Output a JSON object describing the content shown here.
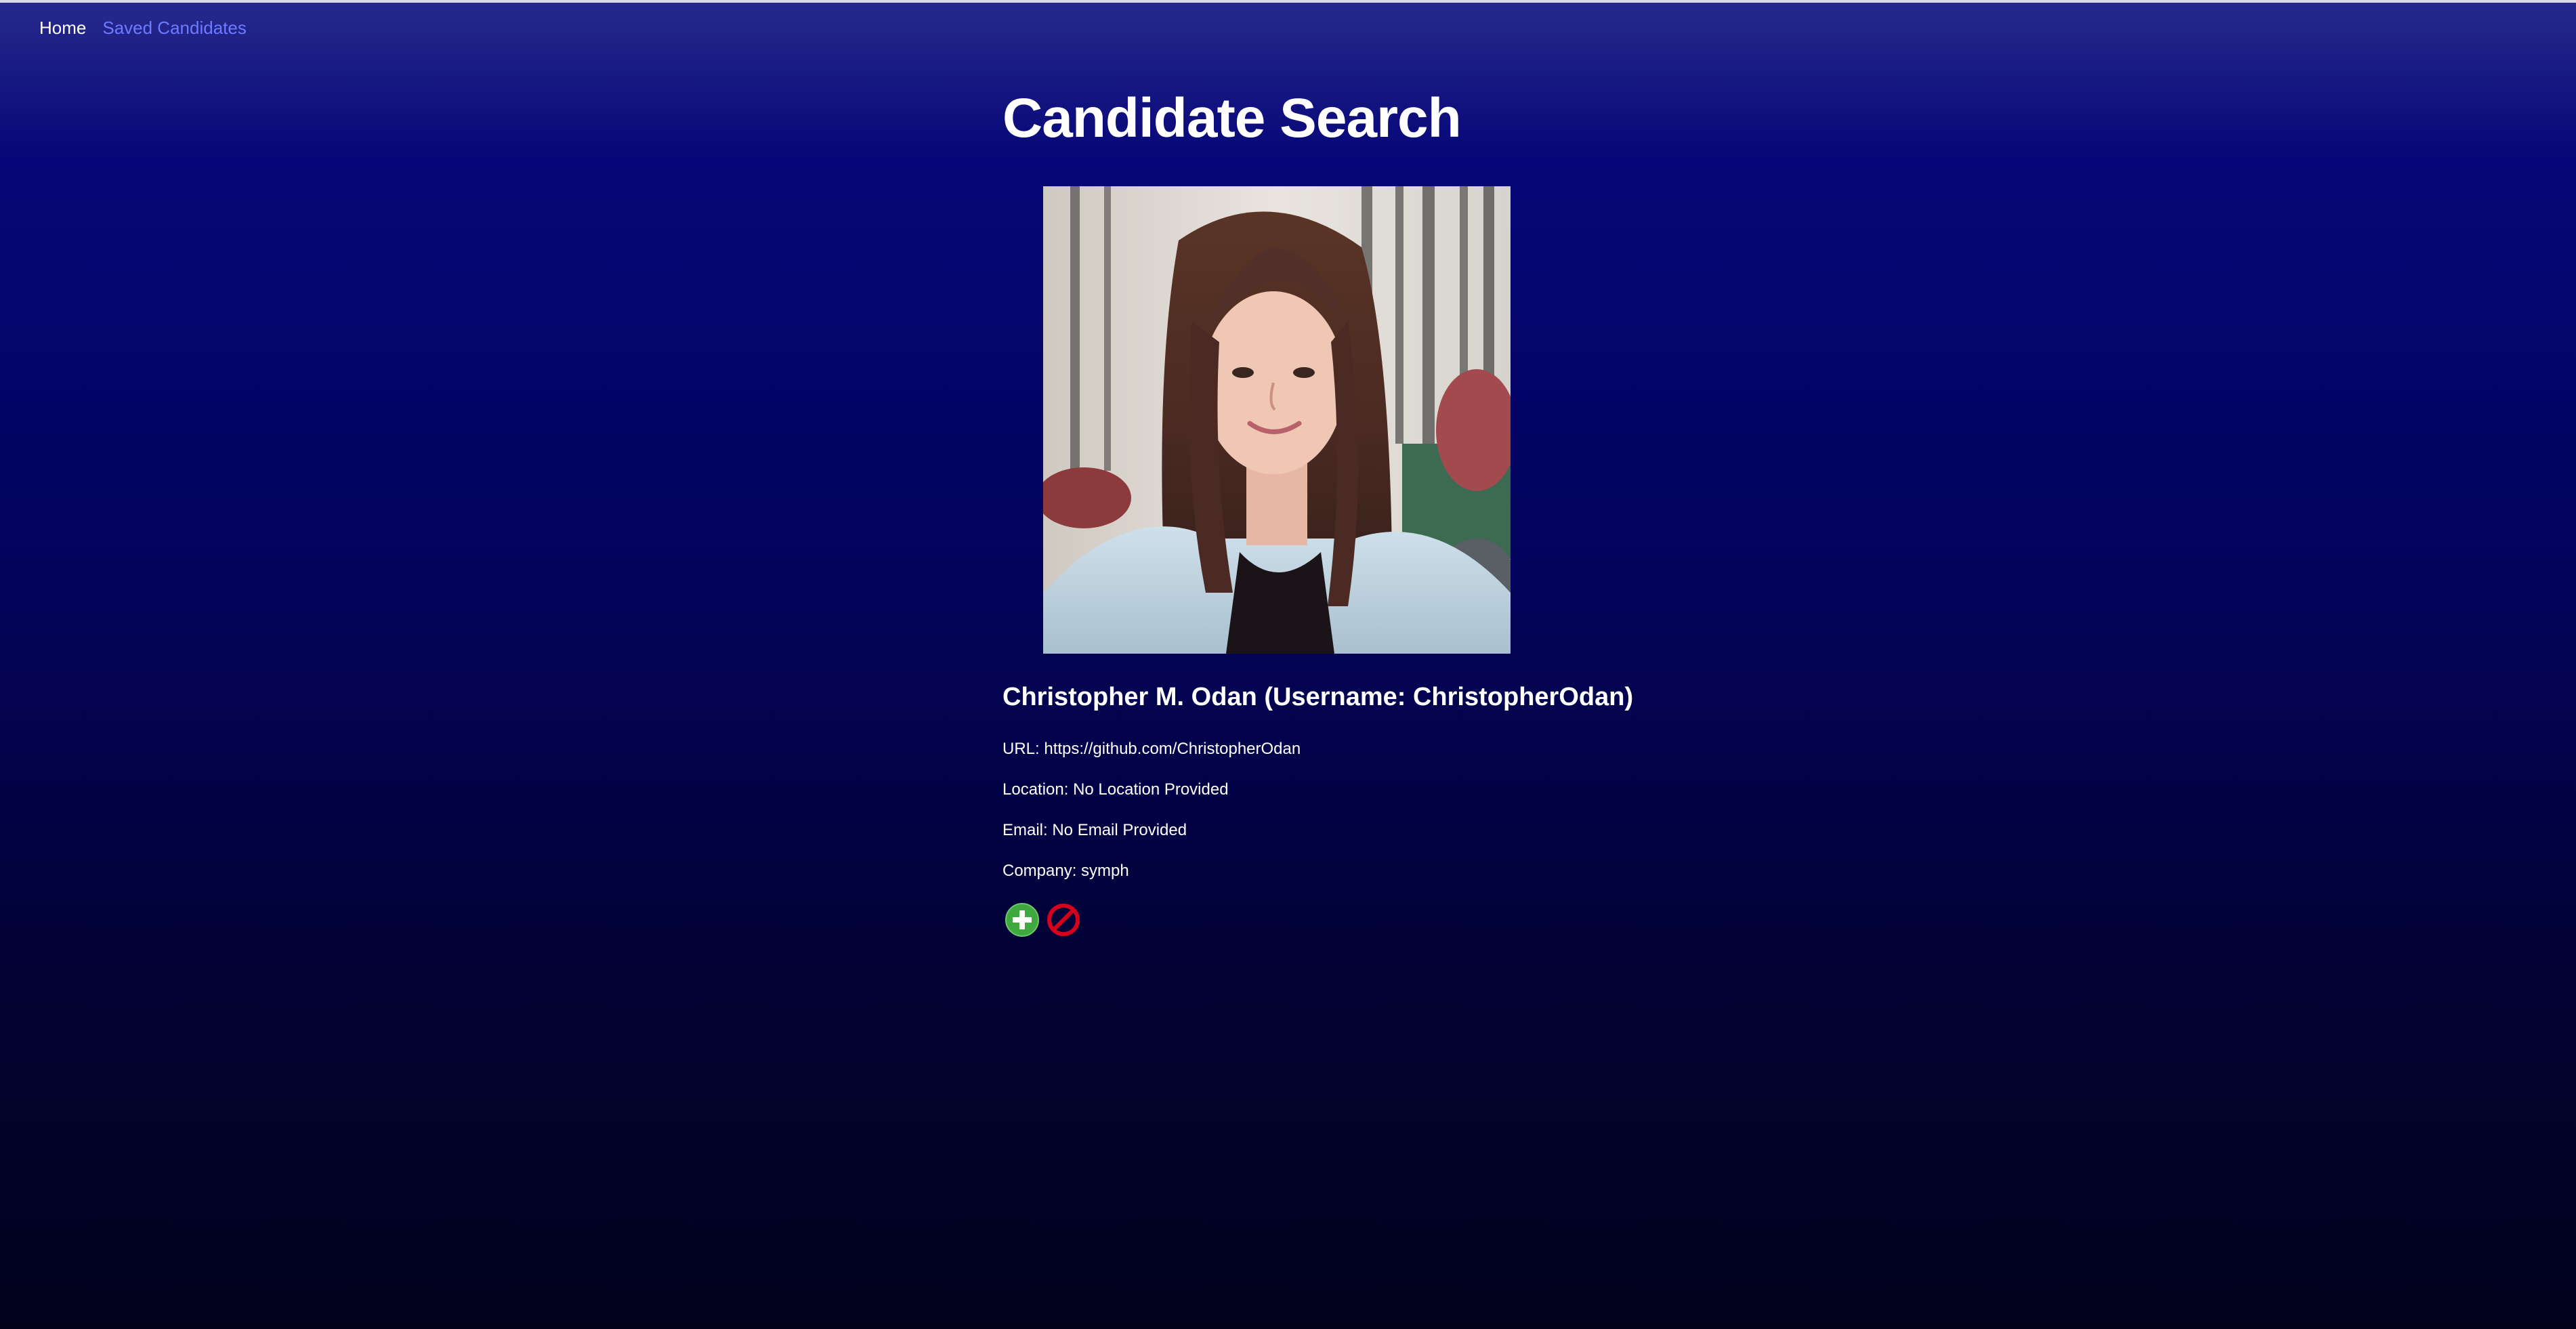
{
  "nav": {
    "home_label": "Home",
    "saved_label": "Saved Candidates"
  },
  "page": {
    "title": "Candidate Search"
  },
  "candidate": {
    "heading": "Christopher M. Odan (Username: ChristopherOdan)",
    "url_line": "URL: https://github.com/ChristopherOdan",
    "location_line": "Location: No Location Provided",
    "email_line": "Email: No Email Provided",
    "company_line": "Company: symph"
  },
  "actions": {
    "add_icon": "plus-circle-icon",
    "reject_icon": "no-entry-icon"
  },
  "colors": {
    "nav_active": "#ffffff",
    "nav_link": "#6f7bff",
    "add_green": "#3fa83f",
    "reject_red": "#d6001c"
  }
}
